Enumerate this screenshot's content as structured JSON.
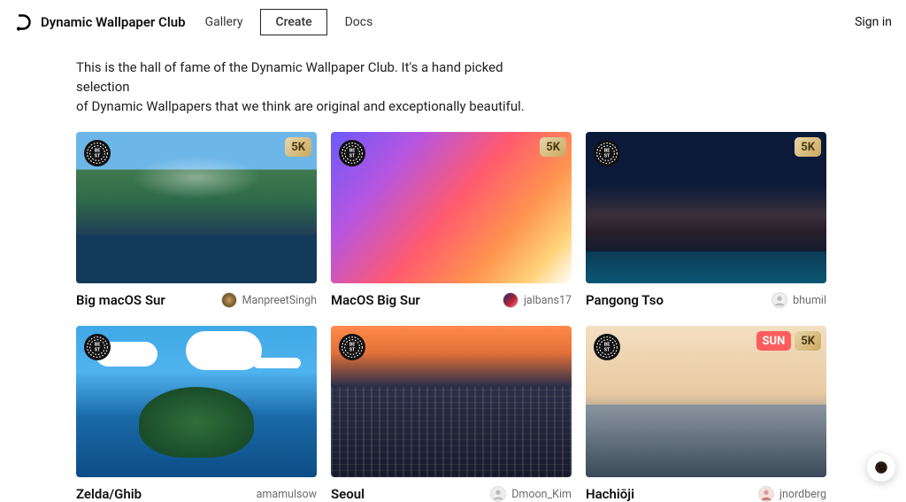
{
  "brand": "Dynamic Wallpaper Club",
  "nav": {
    "gallery": "Gallery",
    "create": "Create",
    "docs": "Docs"
  },
  "signin": "Sign in",
  "intro_line1": "This is the hall of fame of the Dynamic Wallpaper Club. It's a hand picked selection",
  "intro_line2": "of Dynamic Wallpapers that we think are original and exceptionally beautiful.",
  "badges": {
    "best": "BE\nST",
    "fiveK": "5K",
    "sun": "SUN"
  },
  "cards": [
    {
      "title": "Big macOS Sur",
      "author": "ManpreetSingh",
      "fiveK": true,
      "sun": false,
      "avatar": "gradient1"
    },
    {
      "title": "MacOS Big Sur",
      "author": "jalbans17",
      "fiveK": true,
      "sun": false,
      "avatar": "gradient2"
    },
    {
      "title": "Pangong Tso",
      "author": "bhumil",
      "fiveK": true,
      "sun": false,
      "avatar": "placeholder"
    },
    {
      "title": "Zelda/Ghib",
      "author": "amamulsow",
      "fiveK": false,
      "sun": false,
      "avatar": "none"
    },
    {
      "title": "Seoul",
      "author": "Dmoon_Kim",
      "fiveK": false,
      "sun": false,
      "avatar": "placeholder"
    },
    {
      "title": "Hachiōji",
      "author": "jnordberg",
      "fiveK": true,
      "sun": true,
      "avatar": "photo"
    }
  ]
}
